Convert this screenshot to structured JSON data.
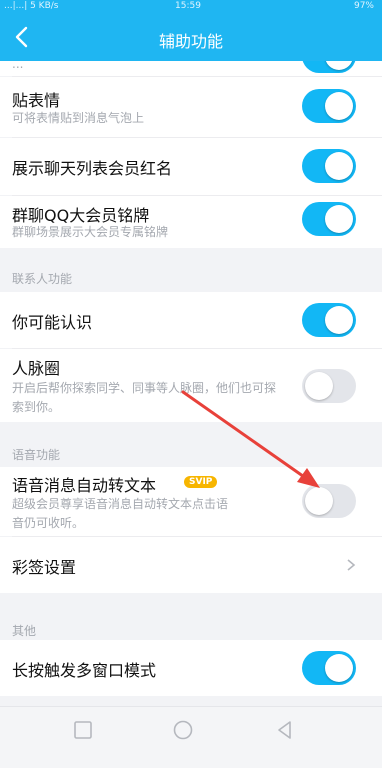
{
  "status": {
    "left": "...|...| 5 KB/s",
    "time": "15:59",
    "right": "97%"
  },
  "header": {
    "title": "辅助功能"
  },
  "partial_item": {
    "subtitle": "..."
  },
  "items": {
    "stickers": {
      "label": "贴表情",
      "subtitle": "可将表情贴到消息气泡上",
      "enabled": true
    },
    "member_red_name": {
      "label": "展示聊天列表会员红名",
      "enabled": true
    },
    "group_badge": {
      "label": "群聊QQ大会员铭牌",
      "subtitle": "群聊场景展示大会员专属铭牌",
      "enabled": true
    },
    "may_know": {
      "label": "你可能认识",
      "enabled": true
    },
    "network": {
      "label": "人脉圈",
      "subtitle": "开启后帮你探索同学、同事等人脉圈，他们也可探索到你。",
      "enabled": false
    },
    "voice_to_text": {
      "label": "语音消息自动转文本",
      "badge": "SVIP",
      "subtitle": "超级会员尊享语音消息自动转文本点击语音仍可收听。",
      "enabled": false
    },
    "color_sign": {
      "label": "彩签设置"
    },
    "multi_window": {
      "label": "长按触发多窗口模式",
      "enabled": true
    }
  },
  "sections": {
    "contacts": "联系人功能",
    "voice": "语音功能",
    "other": "其他"
  },
  "colors": {
    "accent": "#12b7f5",
    "header": "#1fb6f2",
    "annotation_arrow": "#e8413a"
  },
  "icons": [
    "back-arrow-icon",
    "chevron-right-icon",
    "nav-recent-square-icon",
    "nav-home-circle-icon",
    "nav-back-triangle-icon"
  ]
}
